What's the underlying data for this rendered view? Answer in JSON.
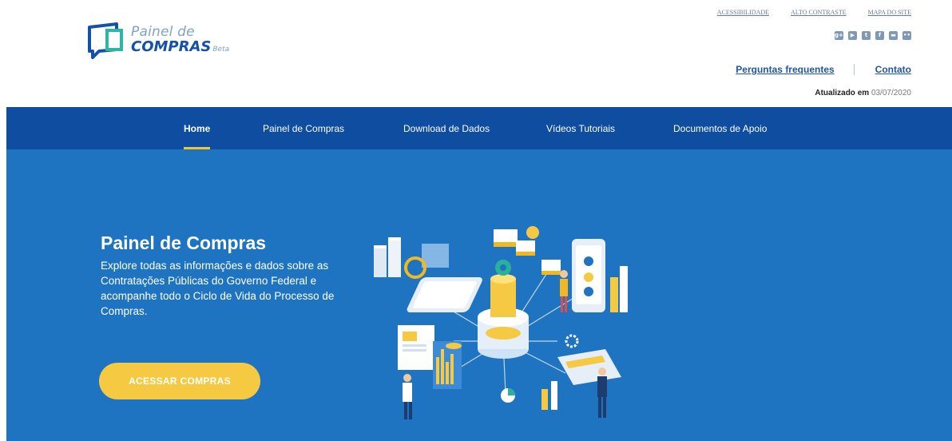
{
  "logo": {
    "line1": "Painel de",
    "line2": "COMPRAS",
    "badge": "Beta"
  },
  "top_links": [
    "ACESSIBILIDADE",
    "ALTO CONTRASTE",
    "MAPA DO SITE"
  ],
  "socials": [
    {
      "name": "google-plus",
      "glyph": "g+"
    },
    {
      "name": "youtube",
      "glyph": "▶"
    },
    {
      "name": "twitter",
      "glyph": "t"
    },
    {
      "name": "facebook",
      "glyph": "f"
    },
    {
      "name": "slideshare",
      "glyph": "▬"
    },
    {
      "name": "flickr",
      "glyph": "••"
    }
  ],
  "help_links": {
    "faq": "Perguntas frequentes",
    "contact": "Contato"
  },
  "updated": {
    "label": "Atualizado em",
    "date": "03/07/2020"
  },
  "nav": {
    "items": [
      "Home",
      "Painel de Compras",
      "Download de Dados",
      "Vídeos Tutoriais",
      "Documentos de Apoio"
    ],
    "active": "Home"
  },
  "hero": {
    "title": "Painel de Compras",
    "text": "Explore todas as informações e dados sobre as Contratações Públicas do Governo Federal e acompanhe todo o Ciclo de Vida do Processo de Compras.",
    "cta": "ACESSAR COMPRAS"
  },
  "colors": {
    "nav_bg": "#0e4da0",
    "hero_bg": "#1f74c2",
    "accent": "#f6c942",
    "link": "#1f56a8"
  }
}
